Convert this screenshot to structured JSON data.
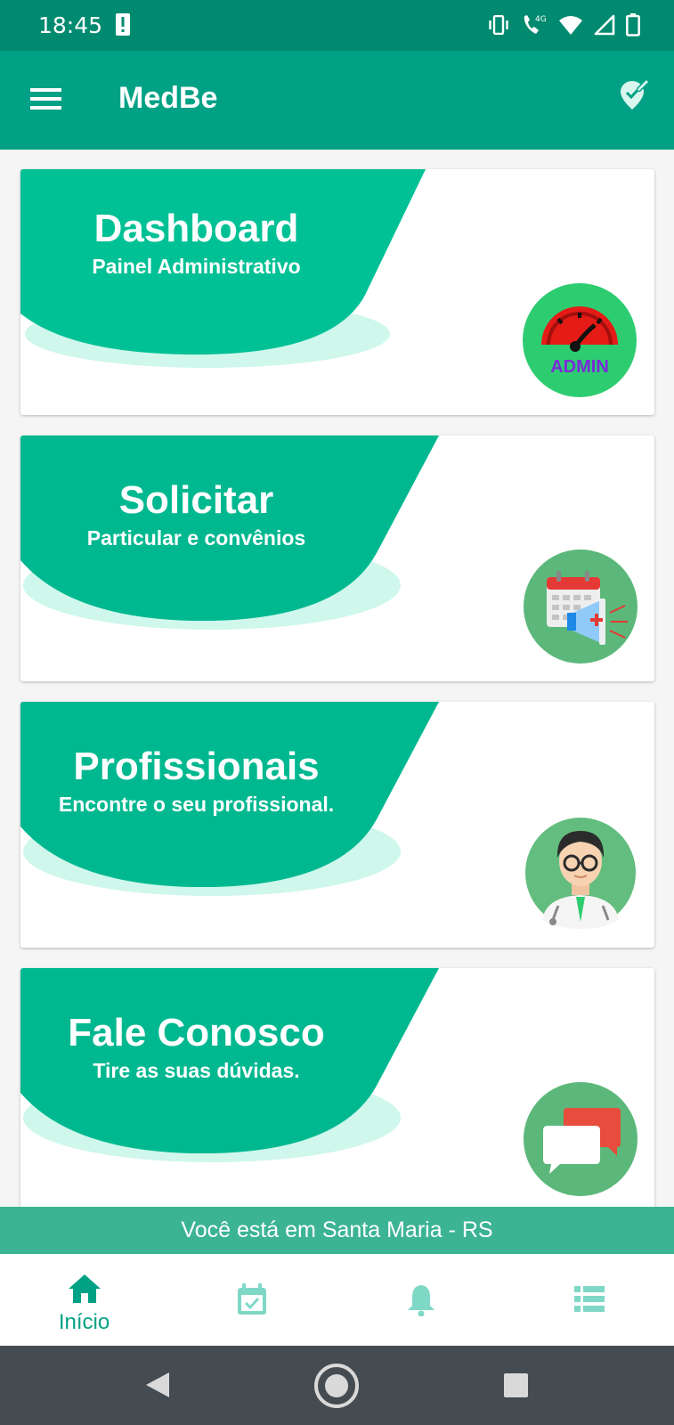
{
  "status_bar": {
    "time": "18:45",
    "icons": [
      "alert-icon",
      "vibrate-icon",
      "call-4g-icon",
      "wifi-icon",
      "signal-icon",
      "battery-icon"
    ]
  },
  "app_bar": {
    "title": "MedBe",
    "menu_icon": "hamburger-menu-icon",
    "action_icon": "location-edit-icon"
  },
  "cards": [
    {
      "title": "Dashboard",
      "subtitle": "Painel Administrativo",
      "icon": "admin-gauge-icon",
      "icon_text": "ADMIN",
      "icon_bg": "#2ecc71"
    },
    {
      "title": "Solicitar",
      "subtitle": "Particular e convênios",
      "icon": "calendar-megaphone-icon",
      "icon_bg": "#5cb87a"
    },
    {
      "title": "Profissionais",
      "subtitle": "Encontre o seu profissional.",
      "icon": "doctor-avatar-icon",
      "icon_bg": "#63bd7e"
    },
    {
      "title": "Fale Conosco",
      "subtitle": "Tire as suas dúvidas.",
      "icon": "chat-bubbles-icon",
      "icon_bg": "#5cb87a"
    }
  ],
  "location_strip": {
    "text": "Você está em Santa Maria - RS"
  },
  "bottom_nav": {
    "items": [
      {
        "label": "Início",
        "icon": "home-icon",
        "active": true
      },
      {
        "label": "",
        "icon": "calendar-check-icon",
        "active": false
      },
      {
        "label": "",
        "icon": "bell-icon",
        "active": false
      },
      {
        "label": "",
        "icon": "list-icon",
        "active": false
      }
    ]
  },
  "system_nav": {
    "icons": [
      "back-icon",
      "home-circle-icon",
      "recents-icon"
    ]
  },
  "colors": {
    "primary": "#00a185",
    "status_bar": "#008a70",
    "card_band": "#00b890",
    "card_band_shadow": "#cff7ec",
    "location_strip": "#3cb494",
    "inactive_nav": "#7fd8c6",
    "system_nav": "#444b51"
  }
}
